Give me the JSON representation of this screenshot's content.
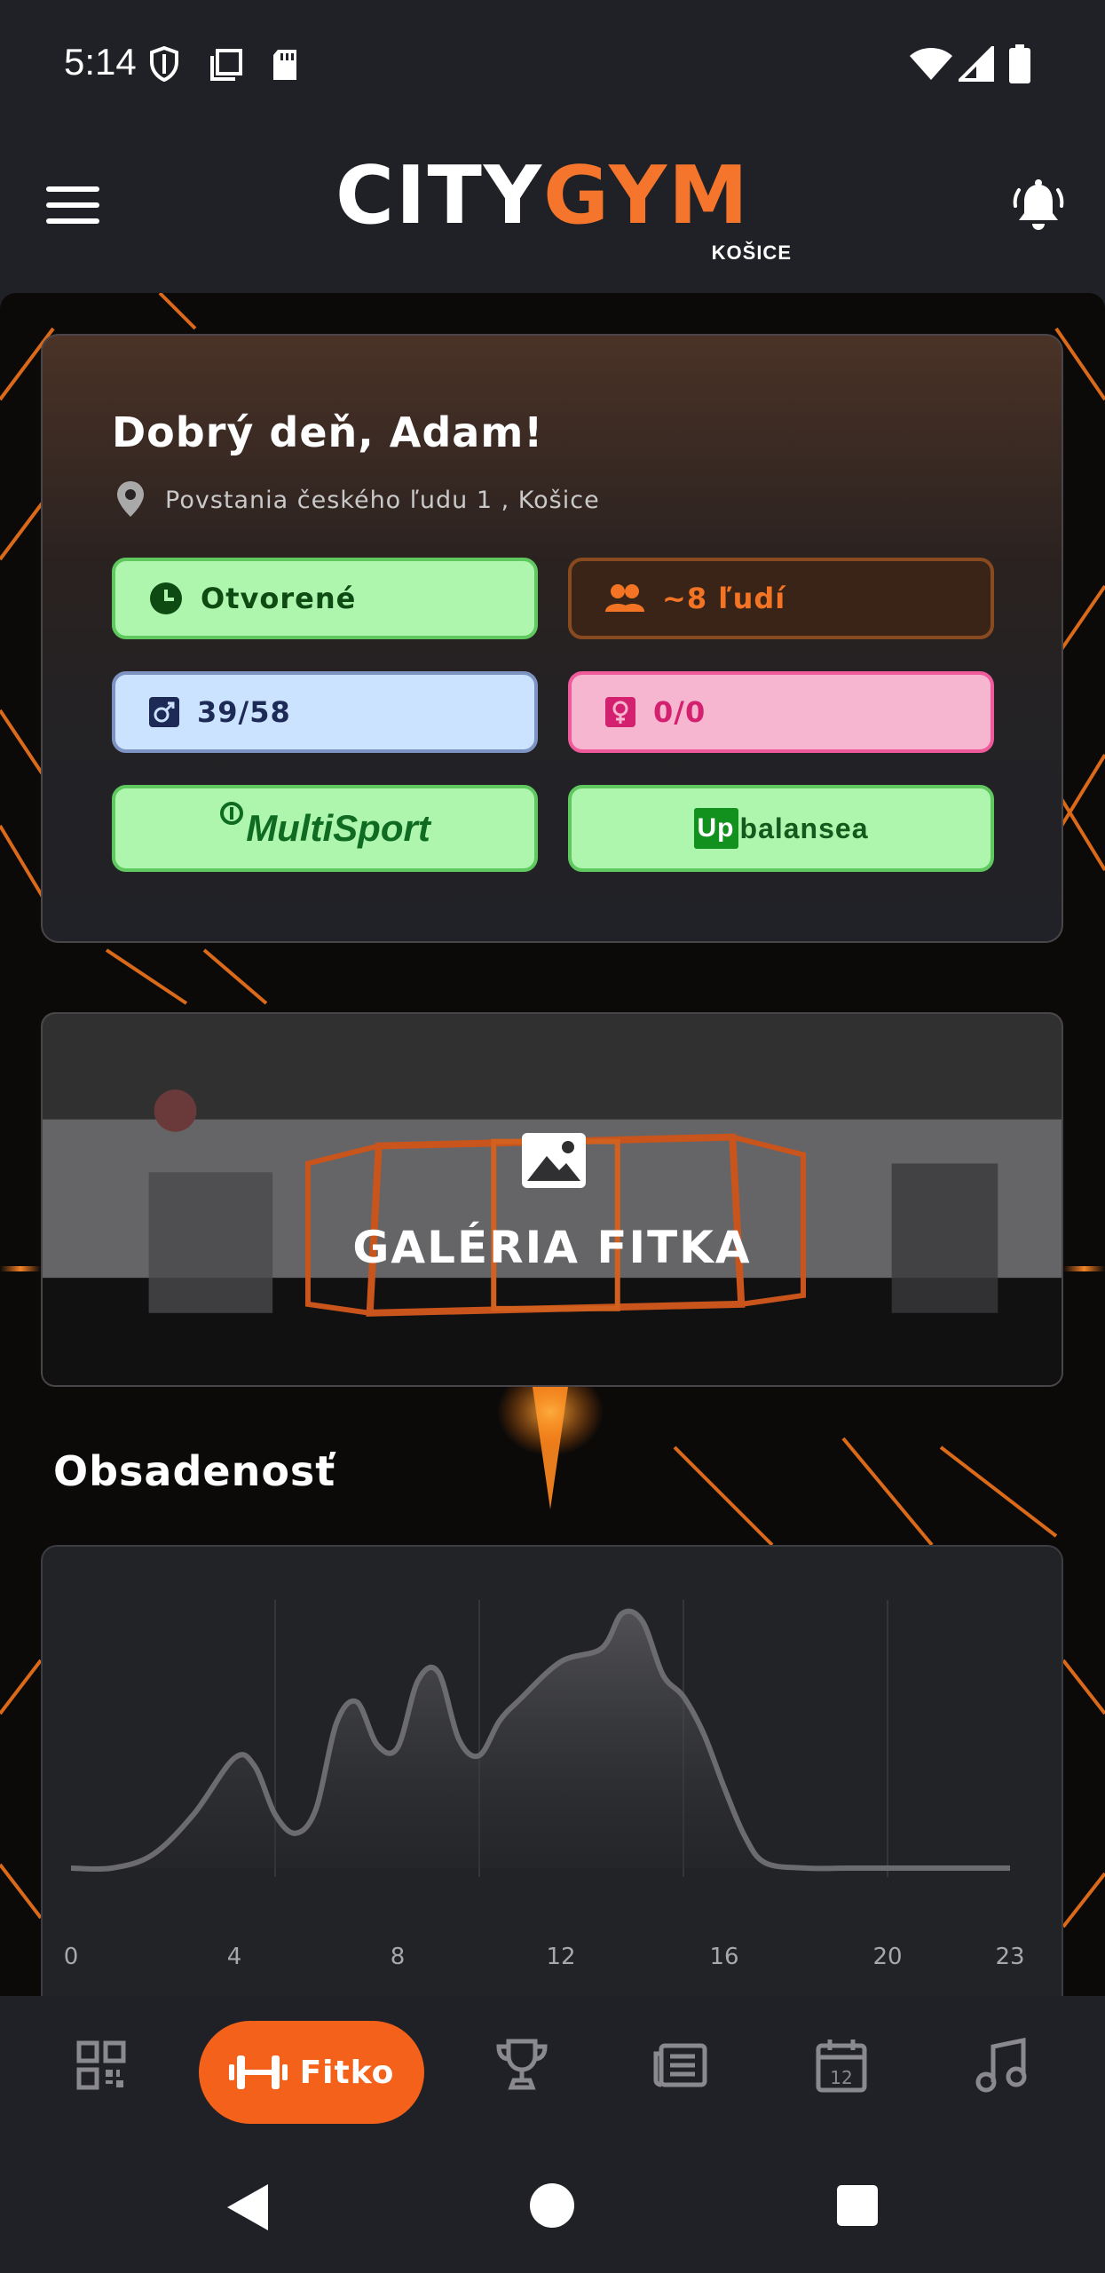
{
  "status_bar": {
    "time": "5:14"
  },
  "header": {
    "logo_city": "CITY",
    "logo_gym": "GYM",
    "logo_sub": "KOŠICE"
  },
  "gym_card": {
    "greeting": "Dobrý deň, Adam!",
    "address": "Povstania českého ľudu 1 , Košice",
    "status": "Otvorené",
    "people": "~8 ľudí",
    "male_count": "39/58",
    "female_count": "0/0",
    "partner_1": "MultiSport",
    "partner_2_box": "Up",
    "partner_2": "balansea"
  },
  "gallery": {
    "label": "GALÉRIA FITKA"
  },
  "occupancy": {
    "title": "Obsadenosť"
  },
  "chart_data": {
    "type": "area",
    "title": "Obsadenosť",
    "xlabel": "",
    "ylabel": "",
    "x_ticks": [
      "0",
      "4",
      "8",
      "12",
      "16",
      "20",
      "23"
    ],
    "xlim": [
      0,
      23
    ],
    "ylim": [
      0,
      1
    ],
    "grid": "vertical",
    "series": [
      {
        "x": [
          0,
          1,
          2,
          3,
          4,
          4.5,
          5,
          5.5,
          6,
          6.5,
          7,
          7.5,
          8,
          8.5,
          9,
          9.5,
          10,
          10.5,
          11,
          12,
          13,
          13.5,
          14,
          14.5,
          15,
          15.5,
          16,
          16.5,
          17,
          18,
          19,
          20,
          21,
          22,
          23
        ],
        "values": [
          0.0,
          0.0,
          0.05,
          0.2,
          0.41,
          0.38,
          0.2,
          0.13,
          0.22,
          0.54,
          0.62,
          0.46,
          0.45,
          0.7,
          0.73,
          0.48,
          0.42,
          0.55,
          0.63,
          0.77,
          0.82,
          0.95,
          0.92,
          0.72,
          0.64,
          0.5,
          0.3,
          0.12,
          0.02,
          0.0,
          0.0,
          0.0,
          0.0,
          0.0,
          0.0
        ]
      }
    ]
  },
  "bottom_nav": {
    "active_label": "Fitko",
    "calendar_day": "12"
  },
  "colors": {
    "accent": "#f4611a",
    "brand_orange": "#f4752b",
    "background": "#202126",
    "chip_green": "#aef5ad"
  }
}
